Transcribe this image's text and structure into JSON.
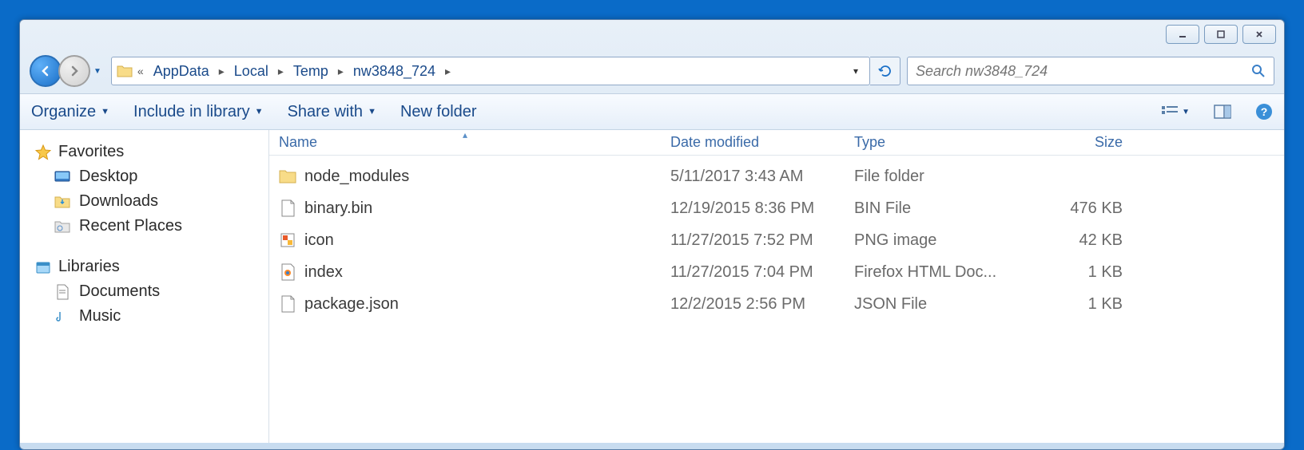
{
  "breadcrumb": [
    "AppData",
    "Local",
    "Temp",
    "nw3848_724"
  ],
  "search": {
    "placeholder": "Search nw3848_724"
  },
  "toolbar": {
    "organize": "Organize",
    "include": "Include in library",
    "share": "Share with",
    "newfolder": "New folder"
  },
  "sidebar": {
    "favorites": {
      "label": "Favorites",
      "items": [
        {
          "label": "Desktop"
        },
        {
          "label": "Downloads"
        },
        {
          "label": "Recent Places"
        }
      ]
    },
    "libraries": {
      "label": "Libraries",
      "items": [
        {
          "label": "Documents"
        },
        {
          "label": "Music"
        }
      ]
    }
  },
  "columns": {
    "name": "Name",
    "date": "Date modified",
    "type": "Type",
    "size": "Size"
  },
  "rows": [
    {
      "name": "node_modules",
      "date": "5/11/2017 3:43 AM",
      "type": "File folder",
      "size": "",
      "icon": "folder"
    },
    {
      "name": "binary.bin",
      "date": "12/19/2015 8:36 PM",
      "type": "BIN File",
      "size": "476 KB",
      "icon": "file"
    },
    {
      "name": "icon",
      "date": "11/27/2015 7:52 PM",
      "type": "PNG image",
      "size": "42 KB",
      "icon": "png"
    },
    {
      "name": "index",
      "date": "11/27/2015 7:04 PM",
      "type": "Firefox HTML Doc...",
      "size": "1 KB",
      "icon": "html"
    },
    {
      "name": "package.json",
      "date": "12/2/2015 2:56 PM",
      "type": "JSON File",
      "size": "1 KB",
      "icon": "file"
    }
  ]
}
